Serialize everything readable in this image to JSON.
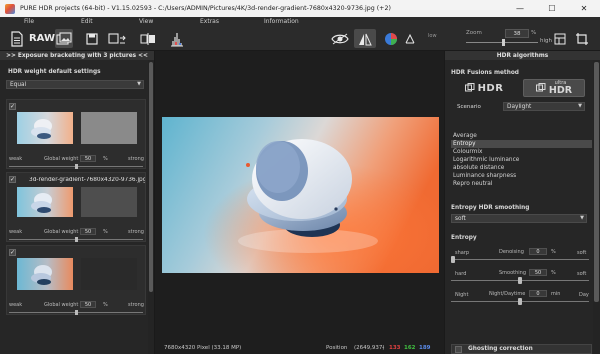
{
  "window": {
    "title": "PURE HDR projects (64-bit) - V1.15.02593 - C:/Users/ADMIN/Pictures/4K/3d-render-gradient-7680x4320-9736.jpg (+2)",
    "minimize": "—",
    "maximize": "☐",
    "close": "✕"
  },
  "menu": [
    "File",
    "Edit",
    "View",
    "Extras",
    "Information"
  ],
  "toolbar": {
    "raw_label": "RAW",
    "low_label": "low",
    "zoom_label": "Zoom",
    "zoom_value": "38",
    "zoom_unit": "%",
    "zoom_level": 0.5,
    "high_label": "high"
  },
  "left_panel": {
    "header": ">> Exposure bracketing with 3 pictures <<",
    "weight_label": "HDR weight default settings",
    "weight_select": "Equal",
    "groups": [
      {
        "file_label": "",
        "weak": "weak",
        "gw_label": "Global weight",
        "gw_value": "50",
        "gw_unit": "%",
        "strong": "strong",
        "checked": true
      },
      {
        "file_label": "3d-render-gradient-7680x4320-9736.jpg",
        "weak": "weak",
        "gw_label": "Global weight",
        "gw_value": "50",
        "gw_unit": "%",
        "strong": "strong",
        "checked": true
      },
      {
        "file_label": "",
        "weak": "weak",
        "gw_label": "Global weight",
        "gw_value": "50",
        "gw_unit": "%",
        "strong": "strong",
        "checked": true
      }
    ]
  },
  "status": {
    "dimensions": "7680x4320 Pixel (33.18 MP)",
    "position_label": "Position",
    "position_value": "(2649,937)",
    "sep": "-",
    "r": "133",
    "g": "162",
    "b": "189",
    "colors": {
      "r": "#e04040",
      "g": "#40c040",
      "b": "#5a8ae8"
    }
  },
  "right_panel": {
    "header": "HDR algorithms",
    "fusion_label": "HDR Fusions method",
    "hdr_label": "HDR",
    "ultra_top": "ultra",
    "ultra_bottom": "HDR",
    "scenario_label": "Scenario",
    "scenario_value": "Daylight",
    "algorithms": [
      "Average",
      "Entropy",
      "Colourmix",
      "Logarithmic luminance",
      "absolute distance",
      "Luminance sharpness",
      "Repro neutral"
    ],
    "selected_algorithm": 1,
    "smoothing_label": "Entropy HDR smoothing",
    "smoothing_value": "soft",
    "entropy_label": "Entropy",
    "denoising": {
      "left": "sharp",
      "label": "Denoising",
      "value": "0",
      "unit": "%",
      "right": "soft",
      "level": 0
    },
    "smoothing": {
      "left": "hard",
      "label": "Smoothing",
      "value": "50",
      "unit": "%",
      "right": "soft",
      "level": 0.5
    },
    "night_day": {
      "left": "Night",
      "label": "Night/Daytime",
      "value": "0",
      "unit": "min",
      "right": "Day",
      "level": 0.5
    },
    "ghosting_label": "Ghosting correction"
  }
}
